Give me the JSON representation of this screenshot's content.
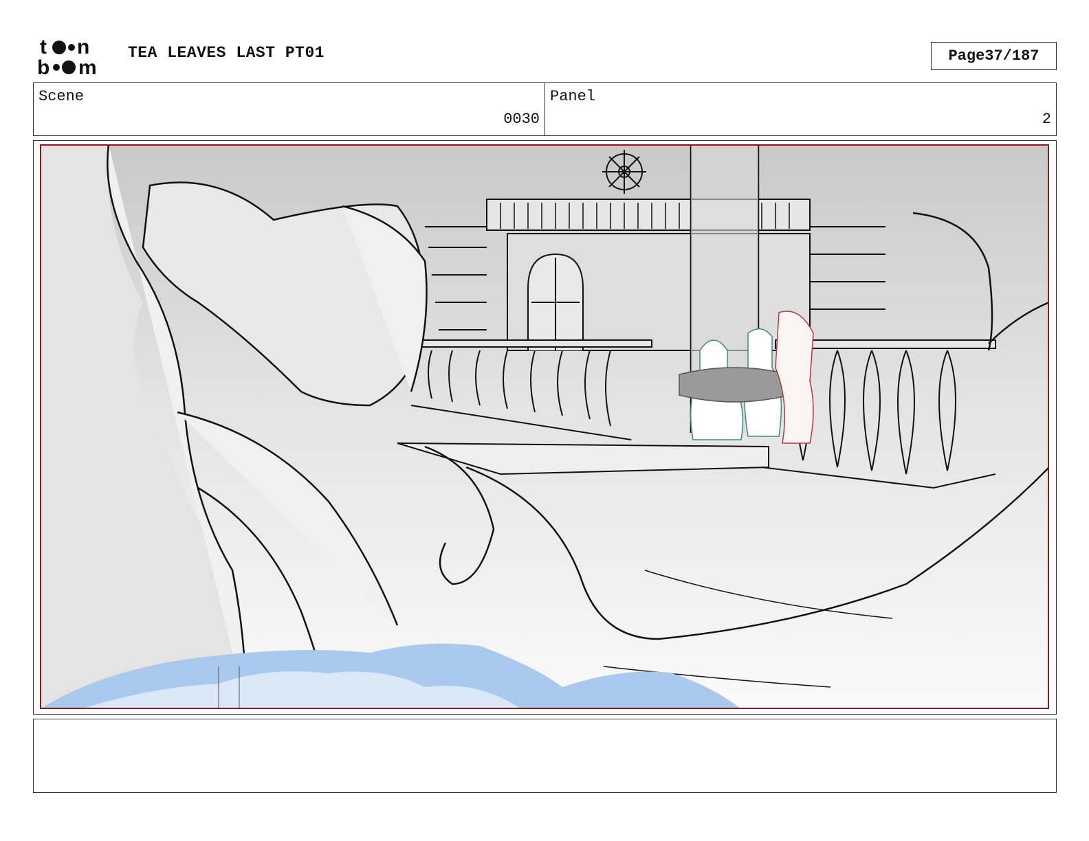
{
  "header": {
    "logo_text": [
      "t",
      "n",
      "b",
      "m"
    ],
    "title": "TEA LEAVES LAST PT01",
    "page_label": "Page",
    "page_value": "37/187"
  },
  "scene": {
    "label": "Scene",
    "value": "0030"
  },
  "panel": {
    "label": "Panel",
    "value": "2"
  },
  "notes": "",
  "colors": {
    "frame_border": "#8b1a1a",
    "sketch_line": "#111111",
    "water": "#a9c9ef",
    "character_teal": "#3d8a82",
    "character_red": "#b23a3a"
  }
}
